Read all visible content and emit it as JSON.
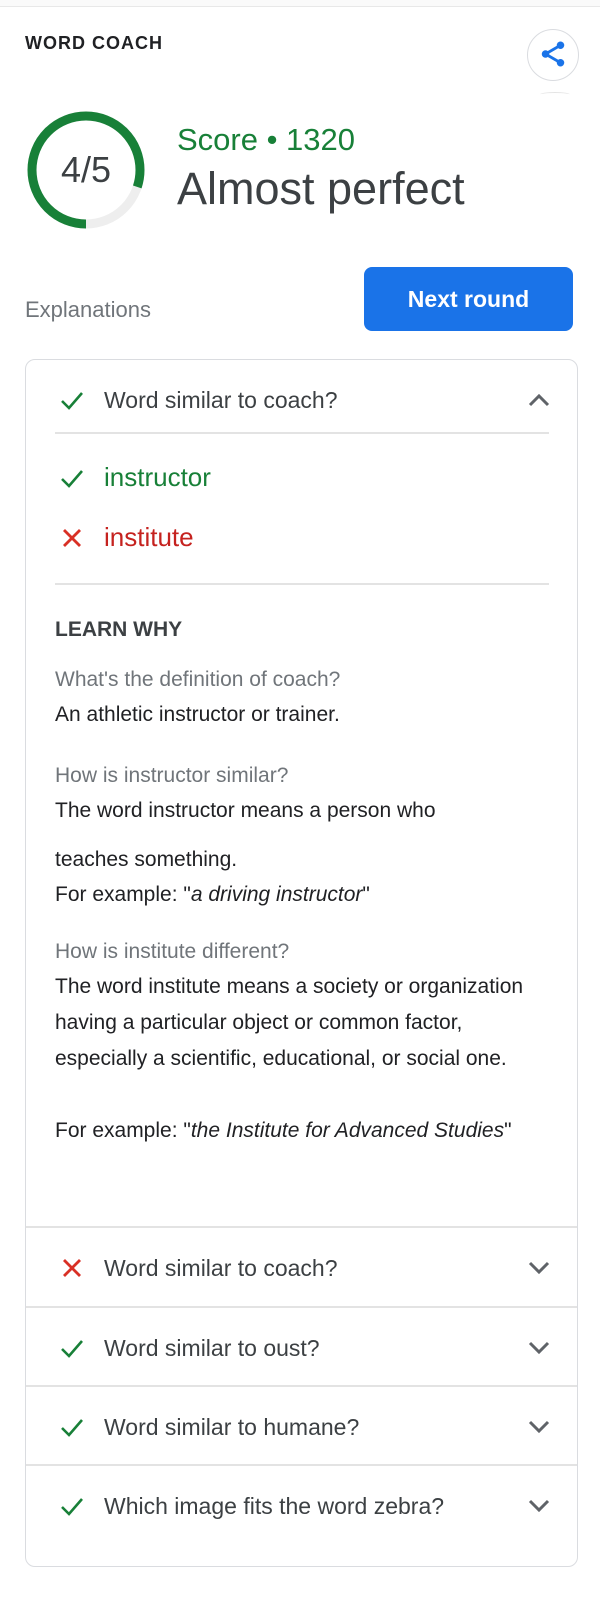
{
  "header": {
    "title": "WORD COACH",
    "share_icon": "share-icon"
  },
  "score": {
    "correct": 4,
    "total": 5,
    "fraction_label": "4/5",
    "progress_fraction": 0.8,
    "score_line": "Score • 1320",
    "verdict": "Almost perfect"
  },
  "explanations_label": "Explanations",
  "next_round_label": "Next round",
  "colors": {
    "accent_blue": "#1a73e8",
    "correct_green": "#188038",
    "wrong_red": "#c5221f",
    "ring_track": "#eeeeee"
  },
  "expanded_question": {
    "status": "correct",
    "status_icon": "check-icon",
    "question": "Word similar to coach?",
    "toggle_icon": "chevron-up-icon",
    "answers": [
      {
        "word": "instructor",
        "status": "correct",
        "icon": "check-icon"
      },
      {
        "word": "institute",
        "status": "wrong",
        "icon": "close-icon"
      }
    ],
    "learn_why": {
      "heading": "LEARN WHY",
      "definition_q": "What's the definition of coach?",
      "definition_a": "An athletic instructor or trainer.",
      "similar_q": "How is instructor similar?",
      "similar_a_line1": "The word instructor means a person who",
      "similar_a_line2": "teaches something.",
      "similar_example_prefix": "For example: \"",
      "similar_example": "a driving instructor",
      "similar_example_suffix": "\"",
      "different_q": "How is institute different?",
      "different_a": "The word institute means a society or organization having a particular object or common factor, especially a scientific, educational, or social one.",
      "different_example_prefix": "For example: \"",
      "different_example": "the Institute for Advanced Studies",
      "different_example_suffix": "\""
    }
  },
  "collapsed_questions": [
    {
      "question": "Word similar to coach?",
      "status": "wrong",
      "icon": "close-icon"
    },
    {
      "question": "Word similar to oust?",
      "status": "correct",
      "icon": "check-icon"
    },
    {
      "question": "Word similar to humane?",
      "status": "correct",
      "icon": "check-icon"
    },
    {
      "question": "Which image fits the word zebra?",
      "status": "correct",
      "icon": "check-icon"
    }
  ]
}
